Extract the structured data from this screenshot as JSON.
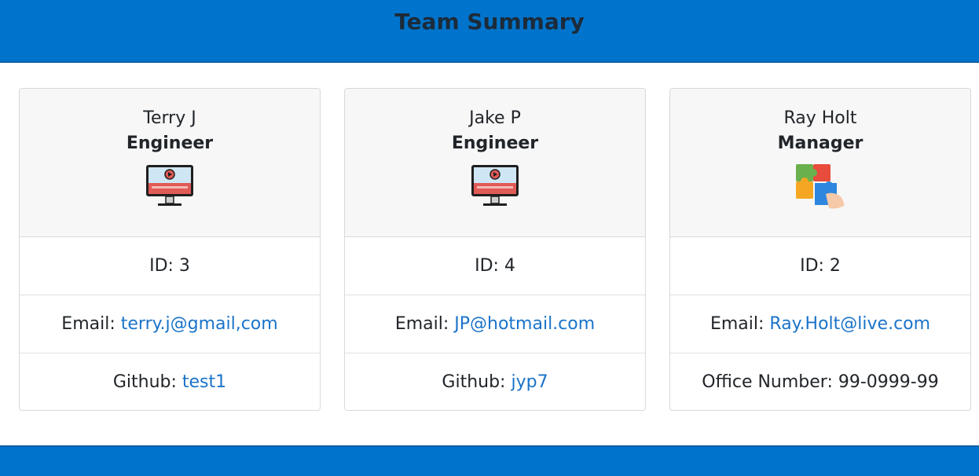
{
  "header": {
    "title": "Team Summary"
  },
  "colors": {
    "header_bg": "#0074cc",
    "link": "#1a73c9",
    "card_head_bg": "#f7f7f7"
  },
  "cards": [
    {
      "name": "Terry J",
      "role": "Engineer",
      "icon": "computer-monitor-icon",
      "id_label": "ID: ",
      "id_value": "3",
      "email_label": "Email: ",
      "email_value": "terry.j@gmail,com",
      "extra_label": "Github: ",
      "extra_value": "test1"
    },
    {
      "name": "Jake P",
      "role": "Engineer",
      "icon": "computer-monitor-icon",
      "id_label": "ID: ",
      "id_value": "4",
      "email_label": "Email: ",
      "email_value": "JP@hotmail.com",
      "extra_label": "Github: ",
      "extra_value": "jyp7"
    },
    {
      "name": "Ray Holt",
      "role": "Manager",
      "icon": "puzzle-pieces-icon",
      "id_label": "ID: ",
      "id_value": "2",
      "email_label": "Email: ",
      "email_value": "Ray.Holt@live.com",
      "extra_label": "Office Number: ",
      "extra_value": "99-0999-99"
    }
  ]
}
